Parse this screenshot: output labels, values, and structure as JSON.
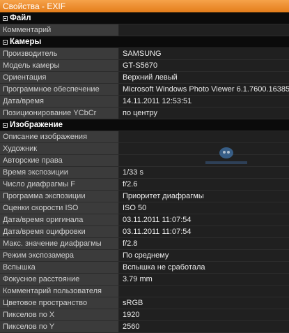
{
  "window": {
    "title": "Свойства - EXIF"
  },
  "sections": [
    {
      "title": "Файл",
      "rows": [
        {
          "key": "Комментарий",
          "value": ""
        }
      ]
    },
    {
      "title": "Камеры",
      "rows": [
        {
          "key": "Производитель",
          "value": "SAMSUNG"
        },
        {
          "key": "Модель камеры",
          "value": "GT-S5670"
        },
        {
          "key": "Ориентация",
          "value": "Верхний левый"
        },
        {
          "key": "Программное обеспечение",
          "value": "Microsoft Windows Photo Viewer 6.1.7600.16385"
        },
        {
          "key": "Дата/время",
          "value": "14.11.2011 12:53:51"
        },
        {
          "key": "Позиционирование YCbCr",
          "value": "по центру"
        }
      ]
    },
    {
      "title": "Изображение",
      "rows": [
        {
          "key": "Описание изображения",
          "value": ""
        },
        {
          "key": "Художник",
          "value": ""
        },
        {
          "key": "Авторские права",
          "value": ""
        },
        {
          "key": "Время экспозиции",
          "value": "1/33 s"
        },
        {
          "key": "Число диафрагмы F",
          "value": "f/2.6"
        },
        {
          "key": "Программа экспозиции",
          "value": "Приоритет диафрагмы"
        },
        {
          "key": "Оценки скорости ISO",
          "value": "ISO 50"
        },
        {
          "key": "Дата/время оригинала",
          "value": "03.11.2011 11:07:54"
        },
        {
          "key": "Дата/время оцифровки",
          "value": "03.11.2011 11:07:54"
        },
        {
          "key": "Макс. значение диафрагмы",
          "value": "f/2.8"
        },
        {
          "key": "Режим экспозамера",
          "value": "По среднему"
        },
        {
          "key": "Вспышка",
          "value": "Вспышка не сработала"
        },
        {
          "key": "Фокусное расстояние",
          "value": "3.79 mm"
        },
        {
          "key": "Комментарий пользователя",
          "value": ""
        },
        {
          "key": "Цветовое пространство",
          "value": "sRGB"
        },
        {
          "key": "Пикселов по X",
          "value": "1920"
        },
        {
          "key": "Пикселов по Y",
          "value": "2560"
        }
      ]
    }
  ],
  "colors": {
    "titlebar": "#e98a28",
    "section_bg": "#0b0b0b",
    "key_bg": "#3b3b3b",
    "value_bg": "#202020"
  },
  "icons": {
    "section_toggle": "collapse-minus-icon",
    "watermark": "mobile-review-logo"
  }
}
